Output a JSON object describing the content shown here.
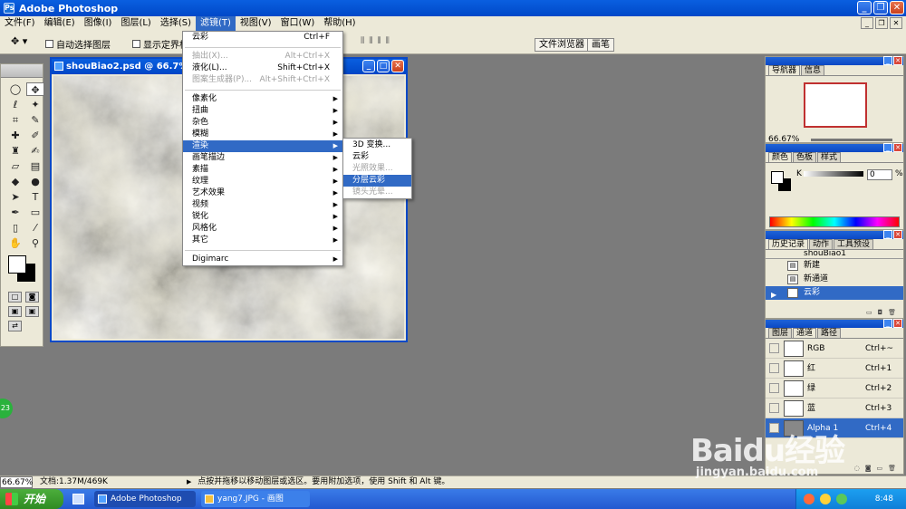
{
  "app": {
    "title": "Adobe Photoshop"
  },
  "menubar": {
    "items": [
      "文件(F)",
      "编辑(E)",
      "图像(I)",
      "图层(L)",
      "选择(S)",
      "滤镜(T)",
      "视图(V)",
      "窗口(W)",
      "帮助(H)"
    ]
  },
  "options": {
    "auto_select": "自动选择图层",
    "show_bounds": "显示定界框",
    "file_browser": "文件浏览器",
    "brushes": "画笔"
  },
  "document": {
    "title": "shouBiao2.psd @ 66.7%"
  },
  "filter_menu": {
    "last_filter": {
      "label": "云彩",
      "shortcut": "Ctrl+F"
    },
    "extract": {
      "label": "抽出(X)...",
      "shortcut": "Alt+Ctrl+X"
    },
    "liquify": {
      "label": "液化(L)...",
      "shortcut": "Shift+Ctrl+X"
    },
    "pattern_maker": {
      "label": "图案生成器(P)...",
      "shortcut": "Alt+Shift+Ctrl+X"
    },
    "categories": [
      "像素化",
      "扭曲",
      "杂色",
      "模糊",
      "渲染",
      "画笔描边",
      "素描",
      "纹理",
      "艺术效果",
      "视频",
      "锐化",
      "风格化",
      "其它"
    ],
    "digimarc": "Digimarc"
  },
  "render_submenu": {
    "items": [
      "3D 变换...",
      "云彩",
      "光照效果...",
      "分层云彩",
      "镜头光晕..."
    ]
  },
  "navigator": {
    "tabs": [
      "导航器",
      "信息"
    ],
    "zoom": "66.67%"
  },
  "color_panel": {
    "tabs": [
      "颜色",
      "色板",
      "样式"
    ],
    "channel": "K",
    "value": "0",
    "unit": "%"
  },
  "history_panel": {
    "tabs": [
      "历史记录",
      "动作",
      "工具预设"
    ],
    "snapshot": "shouBiao1",
    "items": [
      "新建",
      "新通道",
      "云彩"
    ]
  },
  "channels_panel": {
    "tabs": [
      "图层",
      "通道",
      "路径"
    ],
    "channels": [
      {
        "name": "RGB",
        "shortcut": "Ctrl+~"
      },
      {
        "name": "红",
        "shortcut": "Ctrl+1"
      },
      {
        "name": "绿",
        "shortcut": "Ctrl+2"
      },
      {
        "name": "蓝",
        "shortcut": "Ctrl+3"
      },
      {
        "name": "Alpha 1",
        "shortcut": "Ctrl+4"
      }
    ]
  },
  "status": {
    "zoom": "66.67%",
    "doc_size": "文档:1.37M/469K",
    "hint": "点按并拖移以移动图层或选区。要用附加选项，使用 Shift 和 Alt 键。"
  },
  "taskbar": {
    "start": "开始",
    "tasks": [
      "Adobe Photoshop",
      "yang7.JPG - 画图"
    ],
    "clock": "8:48"
  },
  "badge": "23",
  "watermark": {
    "logo": "Baidu经验",
    "url": "jingyan.baidu.com"
  }
}
